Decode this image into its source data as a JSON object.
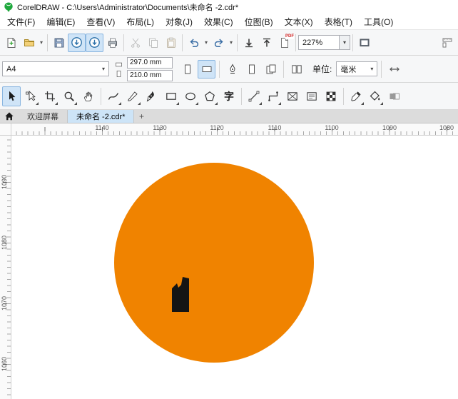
{
  "titlebar": {
    "title": "CorelDRAW - C:\\Users\\Administrator\\Documents\\未命名 -2.cdr*"
  },
  "menubar": {
    "items": [
      "文件(F)",
      "编辑(E)",
      "查看(V)",
      "布局(L)",
      "对象(J)",
      "效果(C)",
      "位图(B)",
      "文本(X)",
      "表格(T)",
      "工具(O)"
    ]
  },
  "toolbar": {
    "zoom_level": "227%",
    "pdf_label": "PDF"
  },
  "property_bar": {
    "page_size": "A4",
    "page_width": "297.0 mm",
    "page_height": "210.0 mm",
    "units_label": "单位:",
    "units_value": "毫米"
  },
  "toolbox": {
    "text_tool_glyph": "字"
  },
  "tabs": {
    "welcome": "欢迎屏幕",
    "document": "未命名 -2.cdr*",
    "new_tab": "+"
  },
  "rulers": {
    "horizontal": [
      "1140",
      "1130",
      "1120",
      "1110",
      "1100",
      "1090",
      "1080"
    ],
    "vertical": [
      "1090",
      "1080",
      "1070",
      "1060"
    ]
  },
  "canvas": {
    "circle_color": "#F08300",
    "shape_color": "#141414"
  }
}
